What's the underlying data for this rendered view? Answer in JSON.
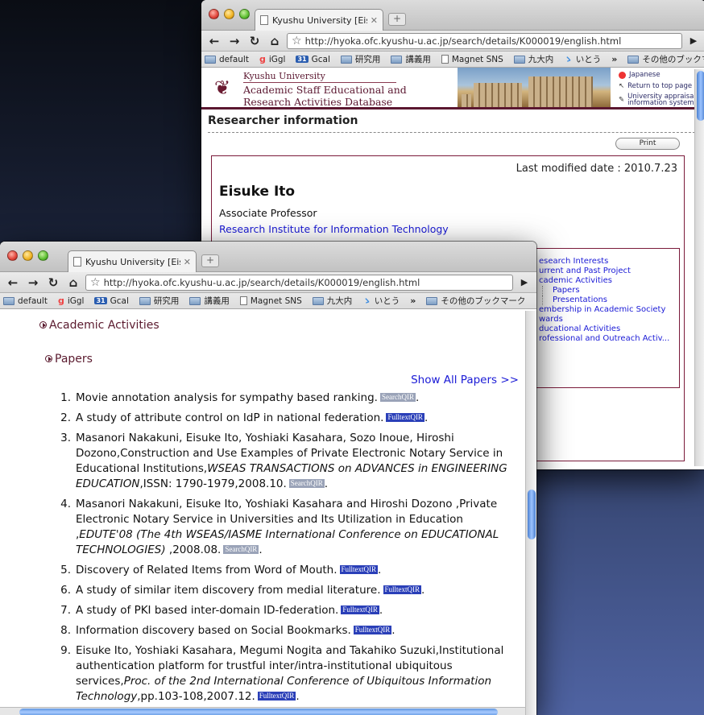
{
  "browser": {
    "tab_title": "Kyushu University [Eisuke Ito",
    "url": "http://hyoka.ofc.kyushu-u.ac.jp/search/details/K000019/english.html",
    "bookmarks": [
      {
        "label": "default",
        "icon": "folder-icon"
      },
      {
        "label": "iGgl",
        "icon": "google-icon"
      },
      {
        "label": "Gcal",
        "icon": "calendar-icon"
      },
      {
        "label": "研究用",
        "icon": "folder-icon"
      },
      {
        "label": "講義用",
        "icon": "folder-icon"
      },
      {
        "label": "Magnet SNS",
        "icon": "page-icon"
      },
      {
        "label": "九大内",
        "icon": "folder-icon"
      },
      {
        "label": "いとう",
        "icon": "link-icon"
      }
    ],
    "overflow": "»",
    "other_bookmarks": "その他のブックマーク"
  },
  "back": {
    "header": {
      "university": "Kyushu University",
      "db_title_1": "Academic Staff Educational and",
      "db_title_2": "Research Activities Database",
      "link_japanese": "Japanese",
      "link_top": "Return to top page",
      "link_appraisal_1": "University appraisal",
      "link_appraisal_2": "information system"
    },
    "section_title": "Researcher information",
    "print_label": "Print",
    "last_modified": "Last modified date : 2010.7.23",
    "name": "Eisuke Ito",
    "rank": "Associate Professor",
    "institute": "Research Institute for Information Technology",
    "toc": [
      {
        "label": "esearch Interests",
        "sub": false
      },
      {
        "label": "urrent and Past Project",
        "sub": false
      },
      {
        "label": "cademic Activities",
        "sub": false
      },
      {
        "label": "Papers",
        "sub": true
      },
      {
        "label": "Presentations",
        "sub": true
      },
      {
        "label": "embership in Academic Society",
        "sub": false
      },
      {
        "label": "wards",
        "sub": false
      },
      {
        "label": "ducational Activities",
        "sub": false
      },
      {
        "label": "rofessional and Outreach Activ...",
        "sub": false
      }
    ]
  },
  "front": {
    "academic_heading": "Academic Activities",
    "papers_heading": "Papers",
    "show_all": "Show All Papers >>",
    "papers": [
      {
        "num": "1.",
        "pre": "Movie annotation analysis for sympathy based ranking.",
        "ital": "",
        "post": "",
        "badge": "SearchQIR",
        "badge_type": "search"
      },
      {
        "num": "2.",
        "pre": "A study of attribute control on IdP in national federation.",
        "ital": "",
        "post": "",
        "badge": "FulltextQIR",
        "badge_type": "full"
      },
      {
        "num": "3.",
        "pre": "Masanori Nakakuni, Eisuke Ito, Yoshiaki Kasahara, Sozo Inoue, Hiroshi Dozono,Construction and Use Examples of Private Electronic Notary Service in Educational Institutions,",
        "ital": "WSEAS TRANSACTIONS on ADVANCES in ENGINEERING EDUCATION",
        "post": ",ISSN: 1790-1979,2008.10.",
        "badge": "SearchQIR",
        "badge_type": "search"
      },
      {
        "num": "4.",
        "pre": "Masanori Nakakuni, Eisuke Ito, Yoshiaki Kasahara and Hiroshi Dozono ,Private Electronic Notary Service in Universities and Its Utilization in Education ,",
        "ital": "EDUTE'08 (The 4th WSEAS/IASME International Conference on EDUCATIONAL TECHNOLOGIES)",
        "post": " ,2008.08.",
        "badge": "SearchQIR",
        "badge_type": "search"
      },
      {
        "num": "5.",
        "pre": "Discovery of Related Items from Word of Mouth.",
        "ital": "",
        "post": "",
        "badge": "FulltextQIR",
        "badge_type": "full"
      },
      {
        "num": "6.",
        "pre": "A study of similar item discovery from medial literature.",
        "ital": "",
        "post": "",
        "badge": "FulltextQIR",
        "badge_type": "full"
      },
      {
        "num": "7.",
        "pre": "A study of PKI based inter-domain ID-federation.",
        "ital": "",
        "post": "",
        "badge": "FulltextQIR",
        "badge_type": "full"
      },
      {
        "num": "8.",
        "pre": "Information discovery based on Social Bookmarks.",
        "ital": "",
        "post": "",
        "badge": "FulltextQIR",
        "badge_type": "full"
      },
      {
        "num": "9.",
        "pre": "Eisuke Ito, Yoshiaki Kasahara, Megumi Nogita and Takahiko Suzuki,Institutional authentication platform for trustful inter/intra-institutional ubiquitous services,",
        "ital": "Proc. of the 2nd International Conference of Ubiquitous Information Technology",
        "post": ",pp.103-108,2007.12.",
        "badge": "FulltextQIR",
        "badge_type": "full"
      }
    ]
  }
}
